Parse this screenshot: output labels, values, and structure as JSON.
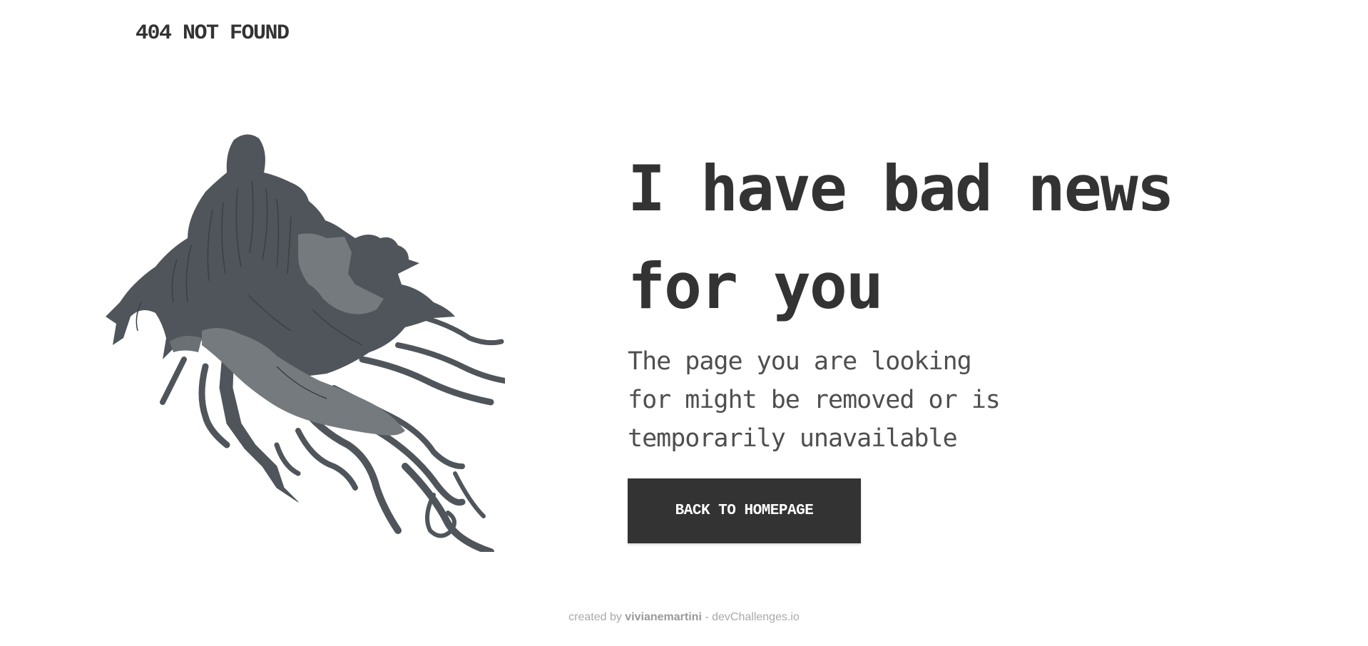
{
  "header": {
    "logo_text": "404 NOT FOUND"
  },
  "illustration": {
    "icon": "dementor-illustration",
    "colors": {
      "dark": "#4f555a",
      "light": "#747a7e",
      "line": "#3b4044"
    }
  },
  "main": {
    "headline_line1": "I have bad news",
    "headline_line2": "for you",
    "description_line1": "The page you are looking",
    "description_line2": "for might be removed or is",
    "description_line3": "temporarily unavailable",
    "button_label": "BACK TO HOMEPAGE"
  },
  "footer": {
    "prefix": "created by ",
    "author": "vivianemartini",
    "suffix": " - devChallenges.io"
  },
  "colors": {
    "text": "#333333",
    "body_text": "#4f4f4f",
    "button_bg": "#333333",
    "button_text": "#ffffff",
    "footer_text": "#a9a9a9"
  }
}
